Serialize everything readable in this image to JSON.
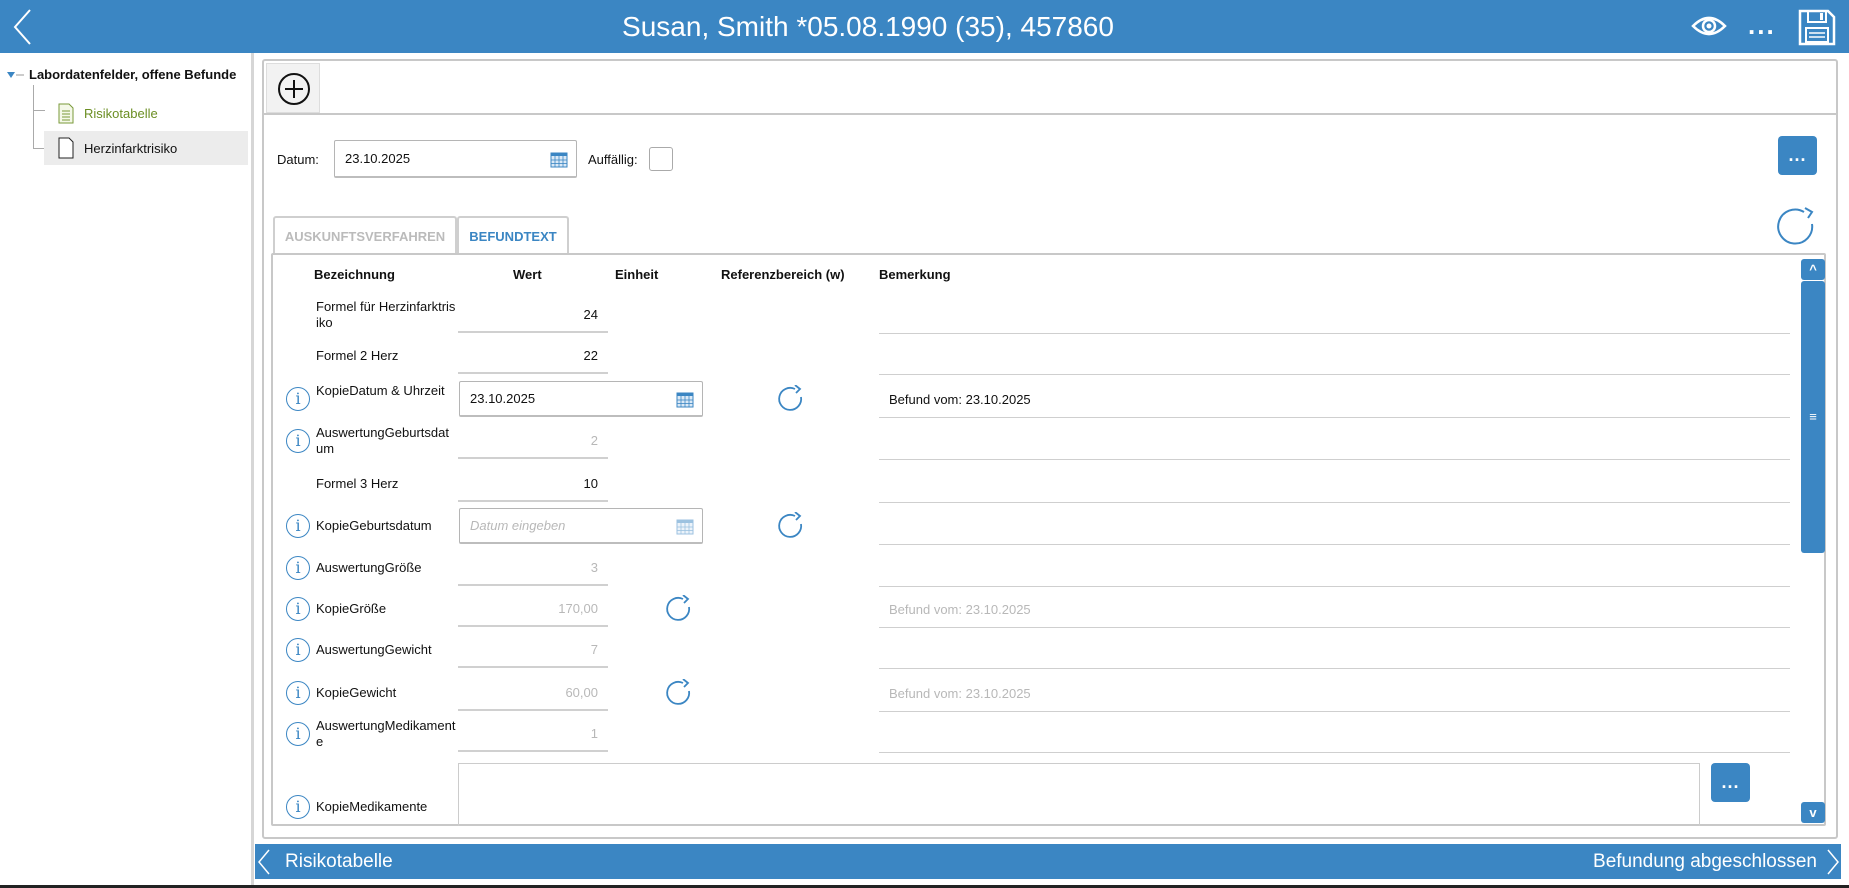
{
  "header": {
    "title": "Susan, Smith *05.08.1990 (35), 457860"
  },
  "sidebar": {
    "root": "Labordatenfelder, offene Befunde",
    "items": [
      {
        "label": "Risikotabelle"
      },
      {
        "label": "Herzinfarktrisiko"
      }
    ]
  },
  "form": {
    "datum_label": "Datum:",
    "datum_value": "23.10.2025",
    "auffaellig_label": "Auffällig:",
    "more_label": "..."
  },
  "tabs": [
    {
      "label": "AUSKUNFTSVERFAHREN"
    },
    {
      "label": "BEFUNDTEXT"
    }
  ],
  "table": {
    "headers": [
      "Bezeichnung",
      "Wert",
      "Einheit",
      "Referenzbereich (w)",
      "Bemerkung"
    ],
    "rows": [
      {
        "label": "Formel für Herzinfarktrisiko",
        "value": "24",
        "remark": ""
      },
      {
        "label": "Formel 2 Herz",
        "value": "22",
        "remark": ""
      },
      {
        "label": "KopieDatum & Uhrzeit",
        "value": "23.10.2025",
        "remark": "Befund vom: 23.10.2025"
      },
      {
        "label": "AuswertungGeburtsdatum",
        "value": "2",
        "remark": ""
      },
      {
        "label": "Formel 3 Herz",
        "value": "10",
        "remark": ""
      },
      {
        "label": "KopieGeburtsdatum",
        "placeholder": "Datum eingeben",
        "remark": ""
      },
      {
        "label": "AuswertungGröße",
        "value": "3",
        "remark": ""
      },
      {
        "label": "KopieGröße",
        "value": "170,00",
        "remark": "Befund vom: 23.10.2025"
      },
      {
        "label": "AuswertungGewicht",
        "value": "7",
        "remark": ""
      },
      {
        "label": "KopieGewicht",
        "value": "60,00",
        "remark": "Befund vom: 23.10.2025"
      },
      {
        "label": "AuswertungMedikamente",
        "value": "1",
        "remark": ""
      },
      {
        "label": "KopieMedikamente",
        "value": "",
        "remark": ""
      }
    ]
  },
  "scroll": {
    "up": "^",
    "down": "v",
    "thumb": "≡"
  },
  "footer": {
    "prev": "Risikotabelle",
    "next": "Befundung abgeschlossen"
  },
  "colors": {
    "accent": "#3b86c3",
    "link_green": "#6b8e23"
  }
}
